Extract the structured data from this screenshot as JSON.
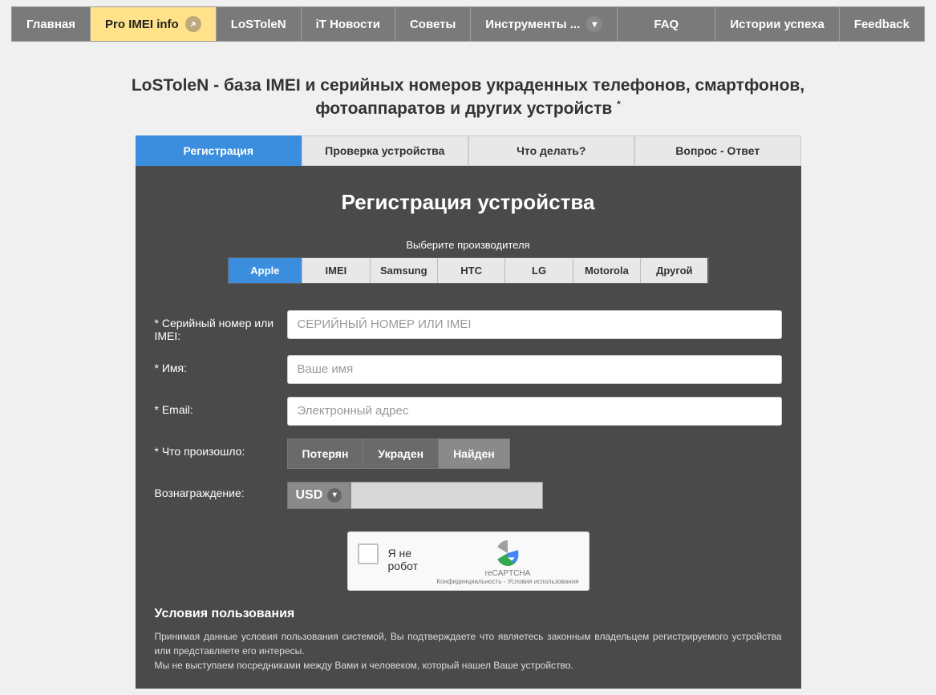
{
  "nav": {
    "items": [
      {
        "label": "Главная"
      },
      {
        "label": "Pro IMEI info",
        "active": true,
        "icon": "external"
      },
      {
        "label": "LoSToleN"
      },
      {
        "label": "iT Новости"
      },
      {
        "label": "Советы"
      },
      {
        "label": "Инструменты ...",
        "icon": "dropdown"
      },
      {
        "label": "FAQ"
      },
      {
        "label": "Истории успеха"
      },
      {
        "label": "Feedback"
      }
    ]
  },
  "page_title_line1": "LoSToleN - база IMEI и серийных номеров украденных телефонов, смартфонов,",
  "page_title_line2": "фотоаппаратов и других устройств",
  "tabs": [
    {
      "label": "Регистрация",
      "active": true
    },
    {
      "label": "Проверка устройства"
    },
    {
      "label": "Что делать?"
    },
    {
      "label": "Вопрос - Ответ"
    }
  ],
  "panel": {
    "heading": "Регистрация устройства",
    "manufacturer_label": "Выберите производителя",
    "manufacturers": [
      {
        "label": "Apple",
        "active": true
      },
      {
        "label": "IMEI"
      },
      {
        "label": "Samsung"
      },
      {
        "label": "HTC"
      },
      {
        "label": "LG"
      },
      {
        "label": "Motorola"
      },
      {
        "label": "Другой"
      }
    ],
    "fields": {
      "serial_label": "* Серийный номер или IMEI:",
      "serial_placeholder": "СЕРИЙНЫЙ НОМЕР ИЛИ IMEI",
      "name_label": "* Имя:",
      "name_placeholder": "Ваше имя",
      "email_label": "* Email:",
      "email_placeholder": "Электронный адрес",
      "incident_label": "* Что произошло:",
      "incident_options": [
        "Потерян",
        "Украден",
        "Найден"
      ],
      "reward_label": "Вознаграждение:",
      "currency": "USD"
    },
    "recaptcha": {
      "label": "Я не робот",
      "brand": "reCAPTCHA",
      "legal": "Конфиденциальность - Условия использования"
    },
    "terms": {
      "heading": "Условия пользования",
      "p1": "Принимая данные условия пользования системой, Вы подтверждаете что являетесь законным владельцем регистрируемого устройства или представляете его интересы.",
      "p2": "Мы не выступаем посредниками между Вами и человеком, который нашел Ваше устройство."
    }
  }
}
